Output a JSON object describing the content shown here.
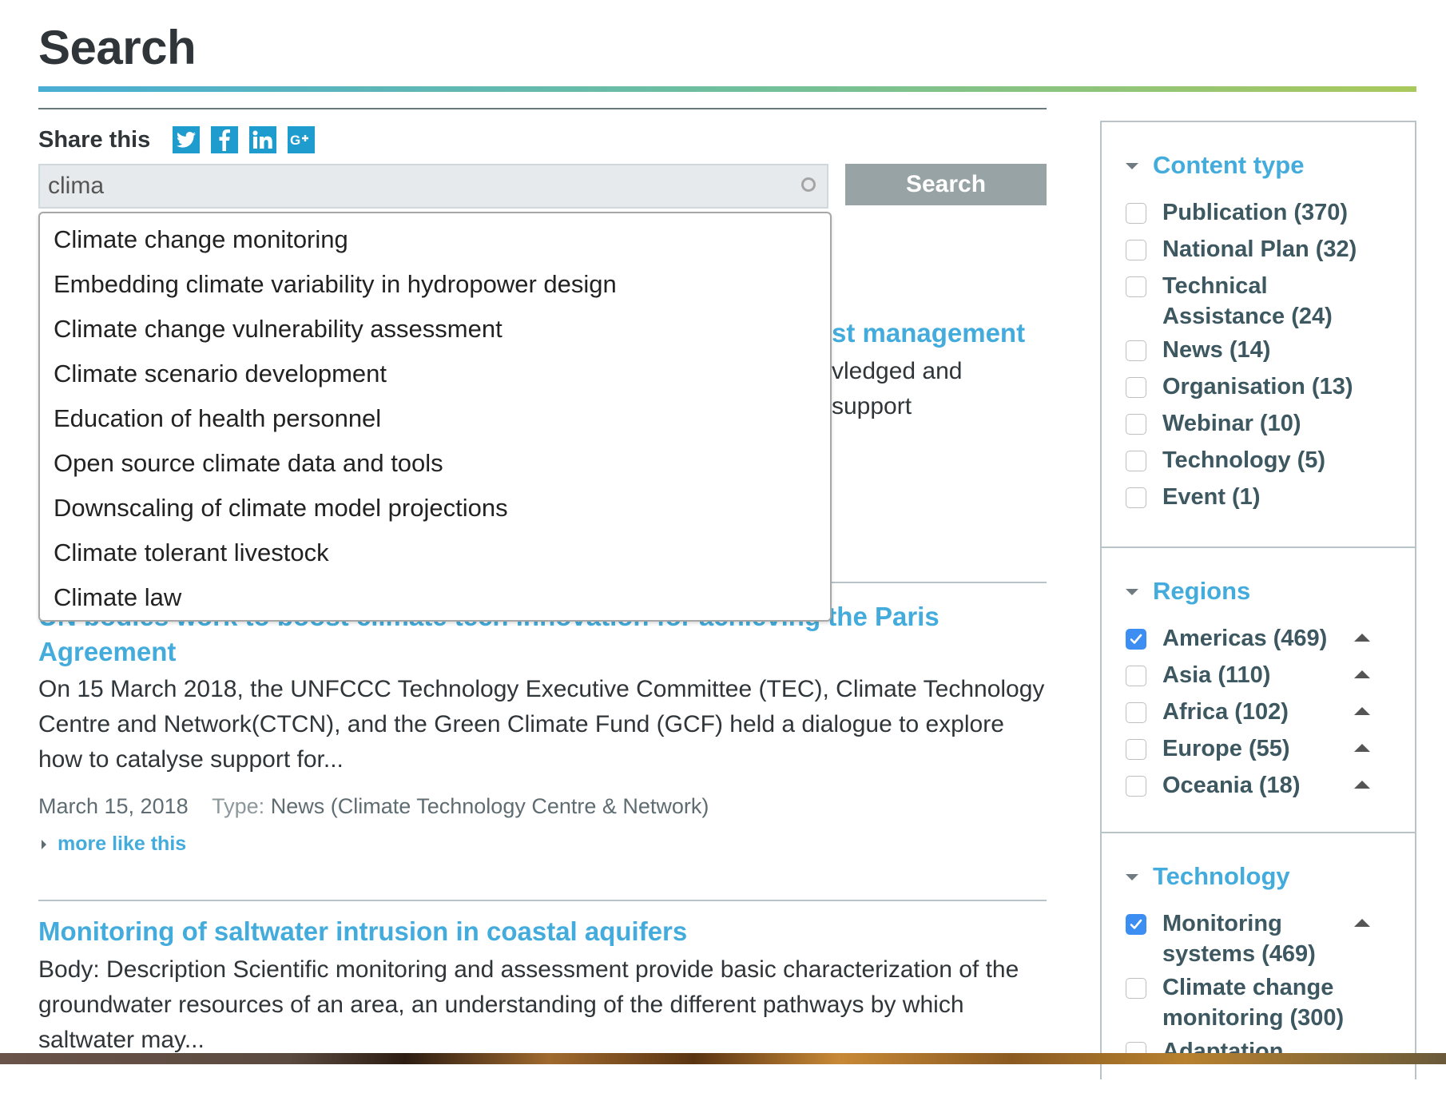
{
  "page": {
    "title": "Search"
  },
  "share": {
    "label": "Share this",
    "icons": [
      "twitter-icon",
      "facebook-icon",
      "linkedin-icon",
      "google-plus-icon"
    ]
  },
  "search": {
    "value": "clima",
    "button_label": "Search"
  },
  "autocomplete": {
    "suggestions": [
      "Climate change monitoring",
      "Embedding climate variability in hydropower design",
      "Climate change vulnerability assessment",
      "Climate scenario development",
      "Education of health personnel",
      "Open source climate data and tools",
      "Downscaling of climate model projections",
      "Climate tolerant livestock",
      "Climate law"
    ]
  },
  "results": [
    {
      "title_visible_fragment": "st management",
      "body_visible_lines": [
        "vledged and",
        "support"
      ]
    },
    {
      "title": "UN bodies work to boost climate tech innovation for achieving the Paris Agreement",
      "body": "On 15 March 2018, the UNFCCC Technology Executive Committee (TEC), Climate Technology Centre and Network(CTCN), and the Green Climate Fund (GCF) held a dialogue to explore how to catalyse support for...",
      "date": "March 15, 2018",
      "type_label": "Type:",
      "type_value": "News (Climate Technology Centre & Network)",
      "more_link": "more like this"
    },
    {
      "title": "Monitoring of saltwater intrusion in coastal aquifers",
      "body": "Body: Description Scientific monitoring and assessment provide basic characterization of the groundwater resources of an area, an understanding of the different pathways by which saltwater may..."
    }
  ],
  "facets": {
    "content_type": {
      "title": "Content type",
      "items": [
        {
          "label": "Publication (370)",
          "checked": false
        },
        {
          "label": "National Plan (32)",
          "checked": false
        },
        {
          "label": "Technical Assistance (24)",
          "checked": false
        },
        {
          "label": "News (14)",
          "checked": false
        },
        {
          "label": "Organisation (13)",
          "checked": false
        },
        {
          "label": "Webinar (10)",
          "checked": false
        },
        {
          "label": "Technology (5)",
          "checked": false
        },
        {
          "label": "Event (1)",
          "checked": false
        }
      ]
    },
    "regions": {
      "title": "Regions",
      "items": [
        {
          "label": "Americas (469)",
          "checked": true
        },
        {
          "label": "Asia (110)",
          "checked": false
        },
        {
          "label": "Africa (102)",
          "checked": false
        },
        {
          "label": "Europe (55)",
          "checked": false
        },
        {
          "label": "Oceania (18)",
          "checked": false
        }
      ]
    },
    "technology": {
      "title": "Technology",
      "items": [
        {
          "label": "Monitoring systems (469)",
          "checked": true
        },
        {
          "label": "Climate change monitoring (300)",
          "checked": false
        },
        {
          "label": "Adaptation",
          "checked": false
        }
      ]
    }
  },
  "colors": {
    "accent_blue": "#43acdc",
    "share_blue": "#1f9cce",
    "checkbox_checked": "#3d8ef3",
    "button_grey": "#98a3a6",
    "facet_label": "#3d5860"
  }
}
